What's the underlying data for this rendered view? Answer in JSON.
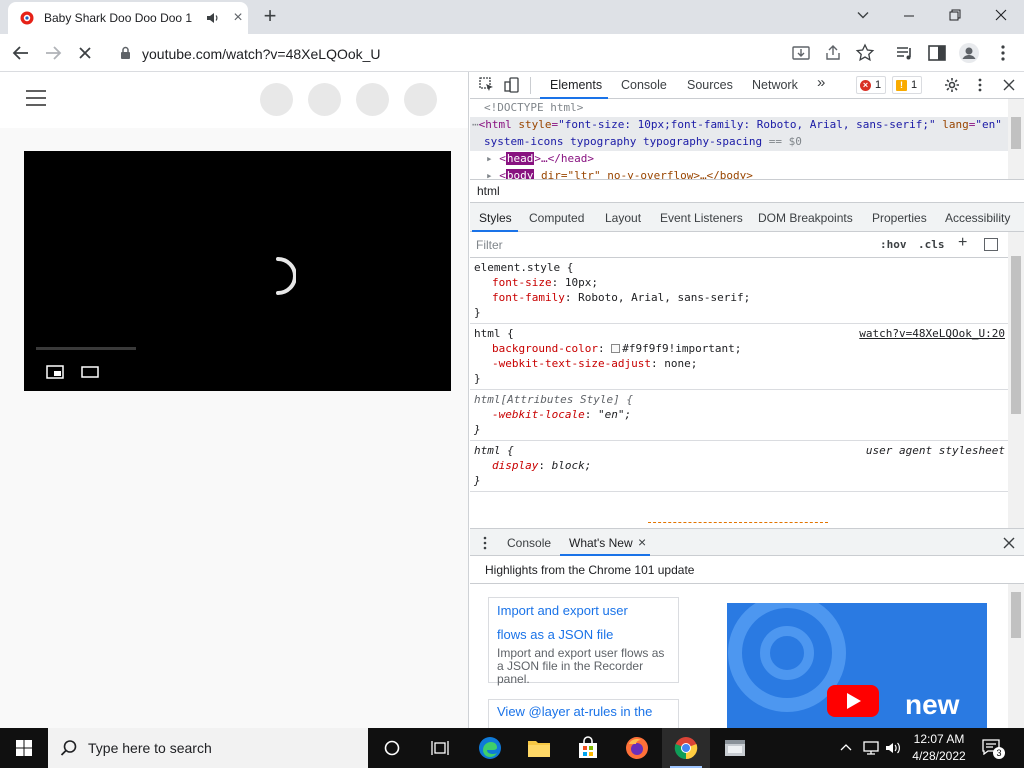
{
  "browser": {
    "tab_title": "Baby Shark Doo Doo Doo 1",
    "url": "youtube.com/watch?v=48XeLQOok_U"
  },
  "devtools": {
    "tabs": [
      "Elements",
      "Console",
      "Sources",
      "Network"
    ],
    "more_tabs": "»",
    "error_count": "1",
    "warning_count": "1",
    "dom": {
      "doctype": "<!DOCTYPE html>",
      "html_open_tag": "html",
      "html_attr_style_name": "style",
      "html_attr_style_value": "\"font-size: 10px;font-family: Roboto, Arial, sans-serif;\"",
      "html_attr_lang_name": "lang",
      "html_attr_lang_value": "\"en\"",
      "html_line2": "system-icons typography typography-spacing",
      "html_line2_suffix": "== $0",
      "head_tag": "head",
      "head_rest": ">…</head>",
      "body_tag": "body",
      "body_rest": " dir=\"ltr\" no-y-overflow>…</body>"
    },
    "breadcrumb": "html",
    "styles_tabs": [
      "Styles",
      "Computed",
      "Layout",
      "Event Listeners",
      "DOM Breakpoints",
      "Properties",
      "Accessibility"
    ],
    "filter_placeholder": "Filter",
    "hov": ":hov",
    "cls": ".cls",
    "rules": {
      "r1_selector": "element.style {",
      "r1_p1_name": "font-size",
      "r1_p1_value": " 10px;",
      "r1_p2_name": "font-family",
      "r1_p2_value": " Roboto, Arial, sans-serif;",
      "close": "}",
      "r2_selector": "html {",
      "r2_source": "watch?v=48XeLQOok_U:20",
      "r2_p1_name": "background-color",
      "r2_p1_value": "#f9f9f9!important;",
      "r2_p2_name": "-webkit-text-size-adjust",
      "r2_p2_value": " none;",
      "r3_selector": "html[Attributes Style] {",
      "r3_p1_name": "-webkit-locale",
      "r3_p1_value": " \"en\";",
      "r4_selector": "html {",
      "r4_source": "user agent stylesheet",
      "r4_p1_name": "display",
      "r4_p1_value": " block;"
    },
    "drawer_tabs": [
      "Console",
      "What's New"
    ],
    "highlights": "Highlights from the Chrome 101 update",
    "card1_link_line1": "Import and export user",
    "card1_link_line2": "flows as a JSON file",
    "card1_desc": "Import and export user flows as a JSON file in the Recorder panel.",
    "card2_link": "View @layer at-rules in the",
    "video_new_text": "new"
  },
  "taskbar": {
    "search_placeholder": "Type here to search",
    "time": "12:07 AM",
    "date": "4/28/2022",
    "notification_count": "3"
  },
  "colors": {
    "accent": "#1a73e8",
    "youtube_red": "#ff0000"
  }
}
